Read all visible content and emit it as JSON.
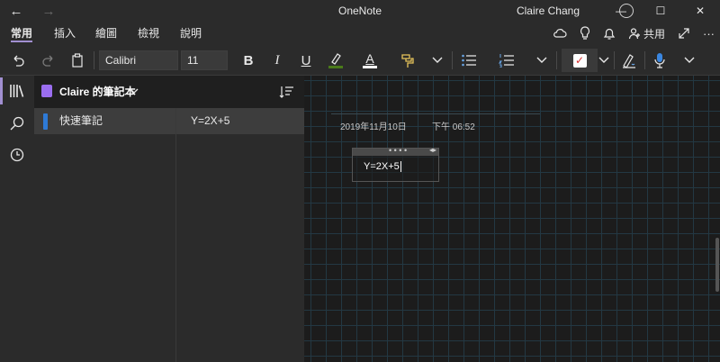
{
  "titlebar": {
    "back": "←",
    "forward": "→",
    "app_title": "OneNote",
    "user": "Claire Chang",
    "minimize": "—",
    "maximize": "☐",
    "close": "✕"
  },
  "menu": {
    "tabs": [
      "常用",
      "插入",
      "繪圖",
      "檢視",
      "說明"
    ],
    "share_label": "共用",
    "more": "···"
  },
  "ribbon": {
    "font_name": "Calibri",
    "font_size": "11",
    "bold": "B",
    "italic": "I",
    "underline": "U",
    "font_color": "A"
  },
  "notebook": {
    "title": "Claire 的筆記本",
    "chevron": "⌄",
    "section_label": "快速筆記",
    "page_label": "Y=2X+5"
  },
  "page": {
    "date": "2019年11月10日",
    "time": "下午 06:52",
    "note_text": "Y=2X+5"
  },
  "colors": {
    "accent": "#a18fd1",
    "section_tab": "#2e7ad6",
    "notebook_icon": "#9b6ef0",
    "grid_line": "#233843"
  },
  "icons": {
    "rail": [
      "notebooks-icon",
      "search-icon",
      "recent-icon"
    ],
    "ribbon": [
      "undo-icon",
      "redo-icon",
      "clipboard-icon",
      "highlighter-icon",
      "format-painter-icon",
      "bullets-icon",
      "numbering-icon",
      "todo-tag-icon",
      "ink-to-text-icon",
      "dictate-icon"
    ]
  }
}
